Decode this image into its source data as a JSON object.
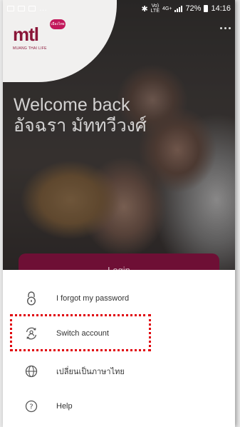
{
  "status_bar": {
    "battery": "72%",
    "time": "14:16",
    "network_top": "Vo)",
    "network_bottom": "LTE",
    "network_4g": "4G+"
  },
  "brand": {
    "logo_text": "mtl",
    "logo_badge": "เมืองไทย",
    "logo_subtitle": "MUANG THAI LIFE",
    "accent_color": "#8a1538"
  },
  "welcome": {
    "line1": "Welcome back",
    "line2": "อัจฉรา มัททวีวงศ์"
  },
  "login_button": {
    "label": "Login"
  },
  "menu": {
    "items": [
      {
        "label": "I forgot my password",
        "icon": "lock-icon"
      },
      {
        "label": "Switch account",
        "icon": "switch-account-icon"
      },
      {
        "label": "เปลี่ยนเป็นภาษาไทย",
        "icon": "globe-icon"
      },
      {
        "label": "Help",
        "icon": "help-icon"
      }
    ]
  },
  "highlight_color": "#e0000a"
}
